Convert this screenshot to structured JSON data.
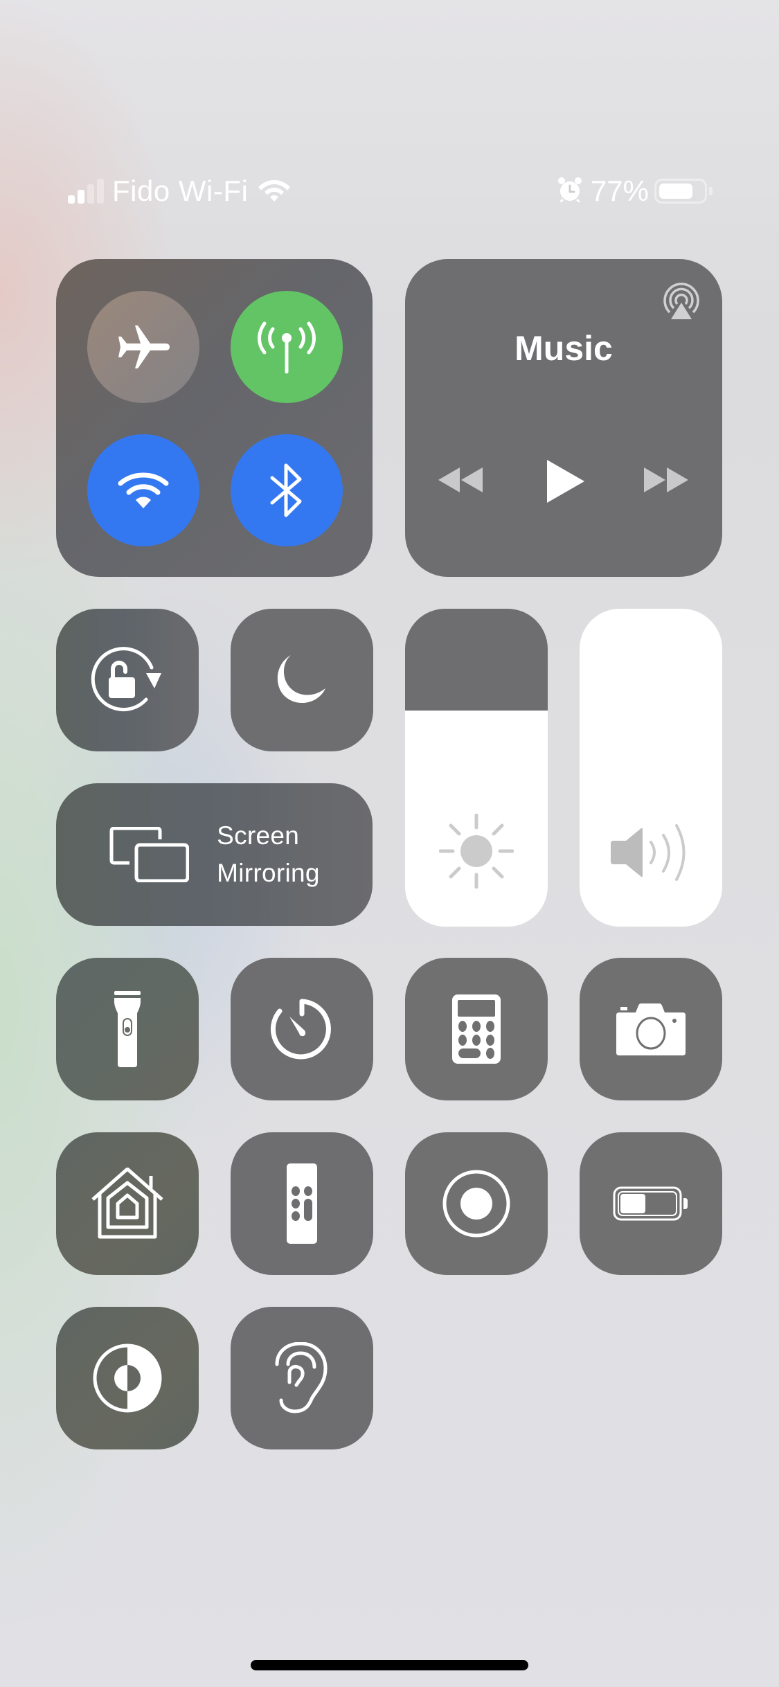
{
  "status_bar": {
    "signal_bars_total": 4,
    "signal_bars_active": 2,
    "carrier": "Fido Wi-Fi",
    "wifi_icon": "wifi-icon",
    "alarm_icon": "alarm-icon",
    "battery_percent_label": "77%",
    "battery_level": 0.77
  },
  "connectivity": {
    "airplane_mode": {
      "icon": "airplane-icon",
      "on": false
    },
    "cellular_data": {
      "icon": "antenna-icon",
      "on": true,
      "color": "#63c466"
    },
    "wifi": {
      "icon": "wifi-icon",
      "on": true,
      "color": "#3478f1"
    },
    "bluetooth": {
      "icon": "bluetooth-icon",
      "on": true,
      "color": "#3478f1"
    }
  },
  "music": {
    "title": "Music",
    "airplay_icon": "airplay-icon",
    "controls": [
      "rewind-icon",
      "play-icon",
      "fast-forward-icon"
    ]
  },
  "toggles": {
    "orientation_lock": {
      "icon": "rotation-lock-icon"
    },
    "do_not_disturb": {
      "icon": "moon-icon"
    }
  },
  "screen_mirroring": {
    "label_line1": "Screen",
    "label_line2": "Mirroring",
    "icon": "screen-mirroring-icon"
  },
  "sliders": {
    "brightness": {
      "icon": "sun-icon",
      "level": 0.68
    },
    "volume": {
      "icon": "speaker-icon",
      "level": 1.0
    }
  },
  "shortcuts": [
    {
      "name": "flashlight",
      "icon": "flashlight-icon"
    },
    {
      "name": "timer",
      "icon": "timer-icon"
    },
    {
      "name": "calculator",
      "icon": "calculator-icon"
    },
    {
      "name": "camera",
      "icon": "camera-icon"
    },
    {
      "name": "home",
      "icon": "home-icon"
    },
    {
      "name": "apple-tv-remote",
      "icon": "remote-icon"
    },
    {
      "name": "screen-recording",
      "icon": "record-icon"
    },
    {
      "name": "low-power-mode",
      "icon": "battery-icon"
    },
    {
      "name": "dark-mode",
      "icon": "dark-mode-icon"
    },
    {
      "name": "hearing",
      "icon": "ear-icon"
    }
  ],
  "colors": {
    "tile": "#6e6e70",
    "accent_blue": "#3478f1",
    "accent_green": "#63c466"
  }
}
